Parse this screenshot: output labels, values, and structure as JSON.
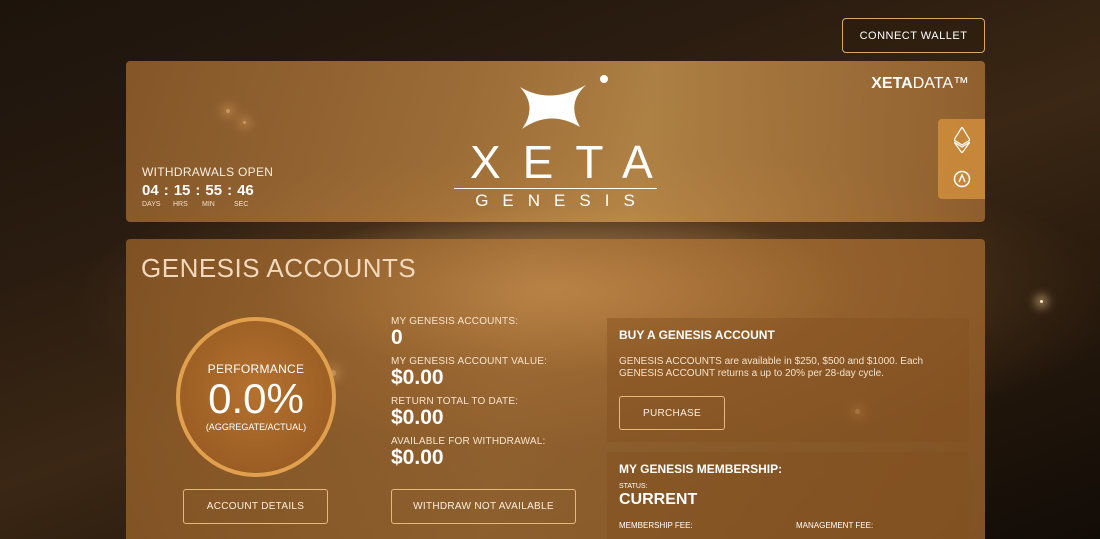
{
  "header": {
    "connect_wallet_label": "CONNECT WALLET"
  },
  "hero": {
    "withdrawals_label": "WITHDRAWALS OPEN",
    "timer": {
      "days": "04",
      "hrs": "15",
      "min": "55",
      "sec": "46",
      "days_label": "DAYS",
      "hrs_label": "HRS",
      "min_label": "MIN",
      "sec_label": "SEC"
    },
    "logo_word": "XETA",
    "logo_sub": "GENESIS",
    "brand_bold": "XETA",
    "brand_rest": "DATA™",
    "side_icons": [
      "ethereum-icon",
      "arbitrum-icon"
    ]
  },
  "accounts": {
    "title": "GENESIS ACCOUNTS",
    "performance": {
      "label": "PERFORMANCE",
      "value": "0.0%",
      "sub": "(AGGREGATE/ACTUAL)"
    },
    "account_details_label": "ACCOUNT DETAILS",
    "stats": [
      {
        "label": "MY GENESIS ACCOUNTS:",
        "value": "0"
      },
      {
        "label": "MY GENESIS ACCOUNT VALUE:",
        "value": "$0.00"
      },
      {
        "label": "RETURN TOTAL TO DATE:",
        "value": "$0.00"
      },
      {
        "label": "AVAILABLE FOR WITHDRAWAL:",
        "value": "$0.00"
      }
    ],
    "withdraw_label": "WITHDRAW NOT AVAILABLE",
    "buy": {
      "title": "BUY A GENESIS ACCOUNT",
      "description": "GENESIS ACCOUNTS are available in $250, $500 and $1000. Each GENESIS ACCOUNT returns a up to 20% per 28-day cycle.",
      "purchase_label": "PURCHASE"
    },
    "membership": {
      "title": "MY GENESIS MEMBERSHIP:",
      "status_label": "STATUS:",
      "status_value": "CURRENT",
      "membership_fee_label": "MEMBERSHIP FEE:",
      "management_fee_label": "MANAGEMENT FEE:"
    }
  },
  "colors": {
    "accent": "#e0a04e",
    "panel": "#b4722f"
  }
}
